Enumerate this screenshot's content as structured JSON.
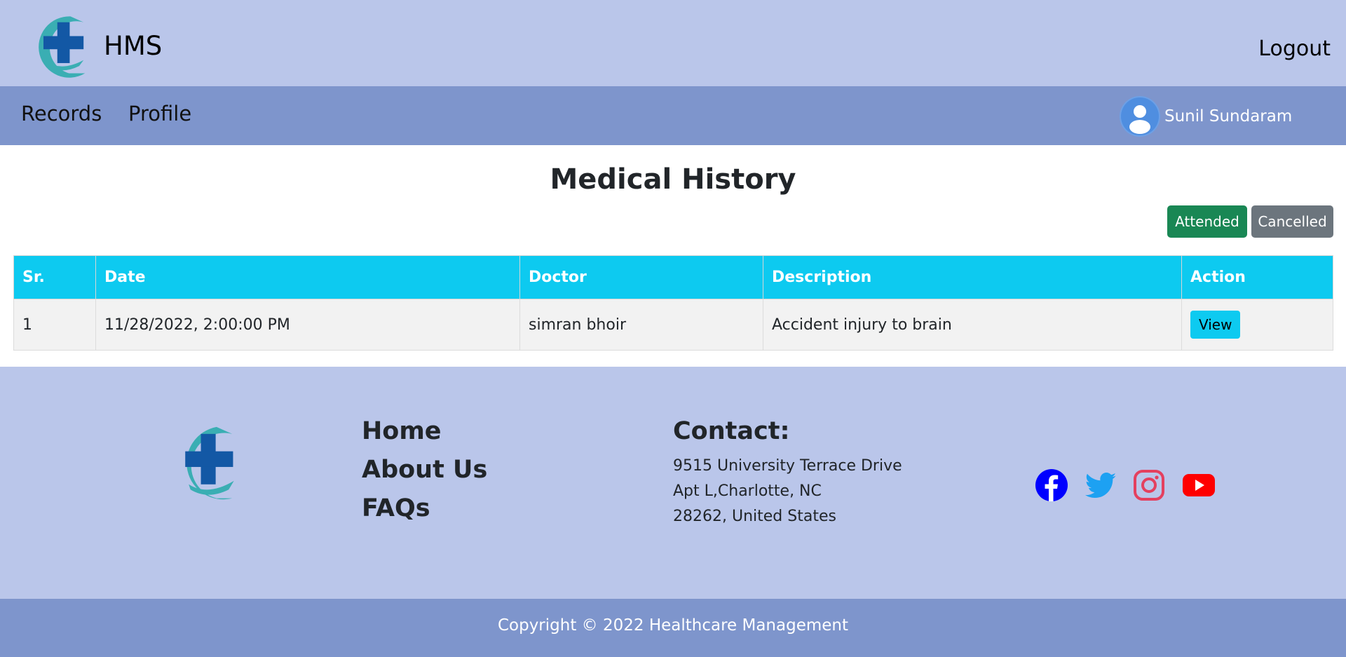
{
  "header": {
    "brand_name": "HMS",
    "logout_label": "Logout"
  },
  "nav": {
    "records_label": "Records",
    "profile_label": "Profile",
    "user_name": "Sunil Sundaram"
  },
  "main": {
    "title": "Medical History",
    "filters": {
      "attended_label": "Attended",
      "cancelled_label": "Cancelled"
    },
    "table": {
      "columns": [
        "Sr.",
        "Date",
        "Doctor",
        "Description",
        "Action"
      ],
      "rows": [
        {
          "sr": "1",
          "date": "11/28/2022, 2:00:00 PM",
          "doctor": "simran bhoir",
          "description": "Accident injury to brain",
          "action": "View"
        }
      ]
    }
  },
  "footer": {
    "links": [
      "Home",
      "About Us",
      "FAQs"
    ],
    "contact_title": "Contact:",
    "address_lines": [
      "9515 University Terrace Drive",
      "Apt L,Charlotte, NC",
      "28262, United States"
    ],
    "social_icons": [
      "facebook-icon",
      "twitter-icon",
      "instagram-icon",
      "youtube-icon"
    ],
    "copyright": "Copyright  © 2022 Healthcare Management"
  },
  "colors": {
    "header_bg": "#bac6ea",
    "nav_bg": "#7e95cc",
    "table_header": "#0dcaf0",
    "attended": "#198754",
    "cancelled": "#6c757d"
  }
}
